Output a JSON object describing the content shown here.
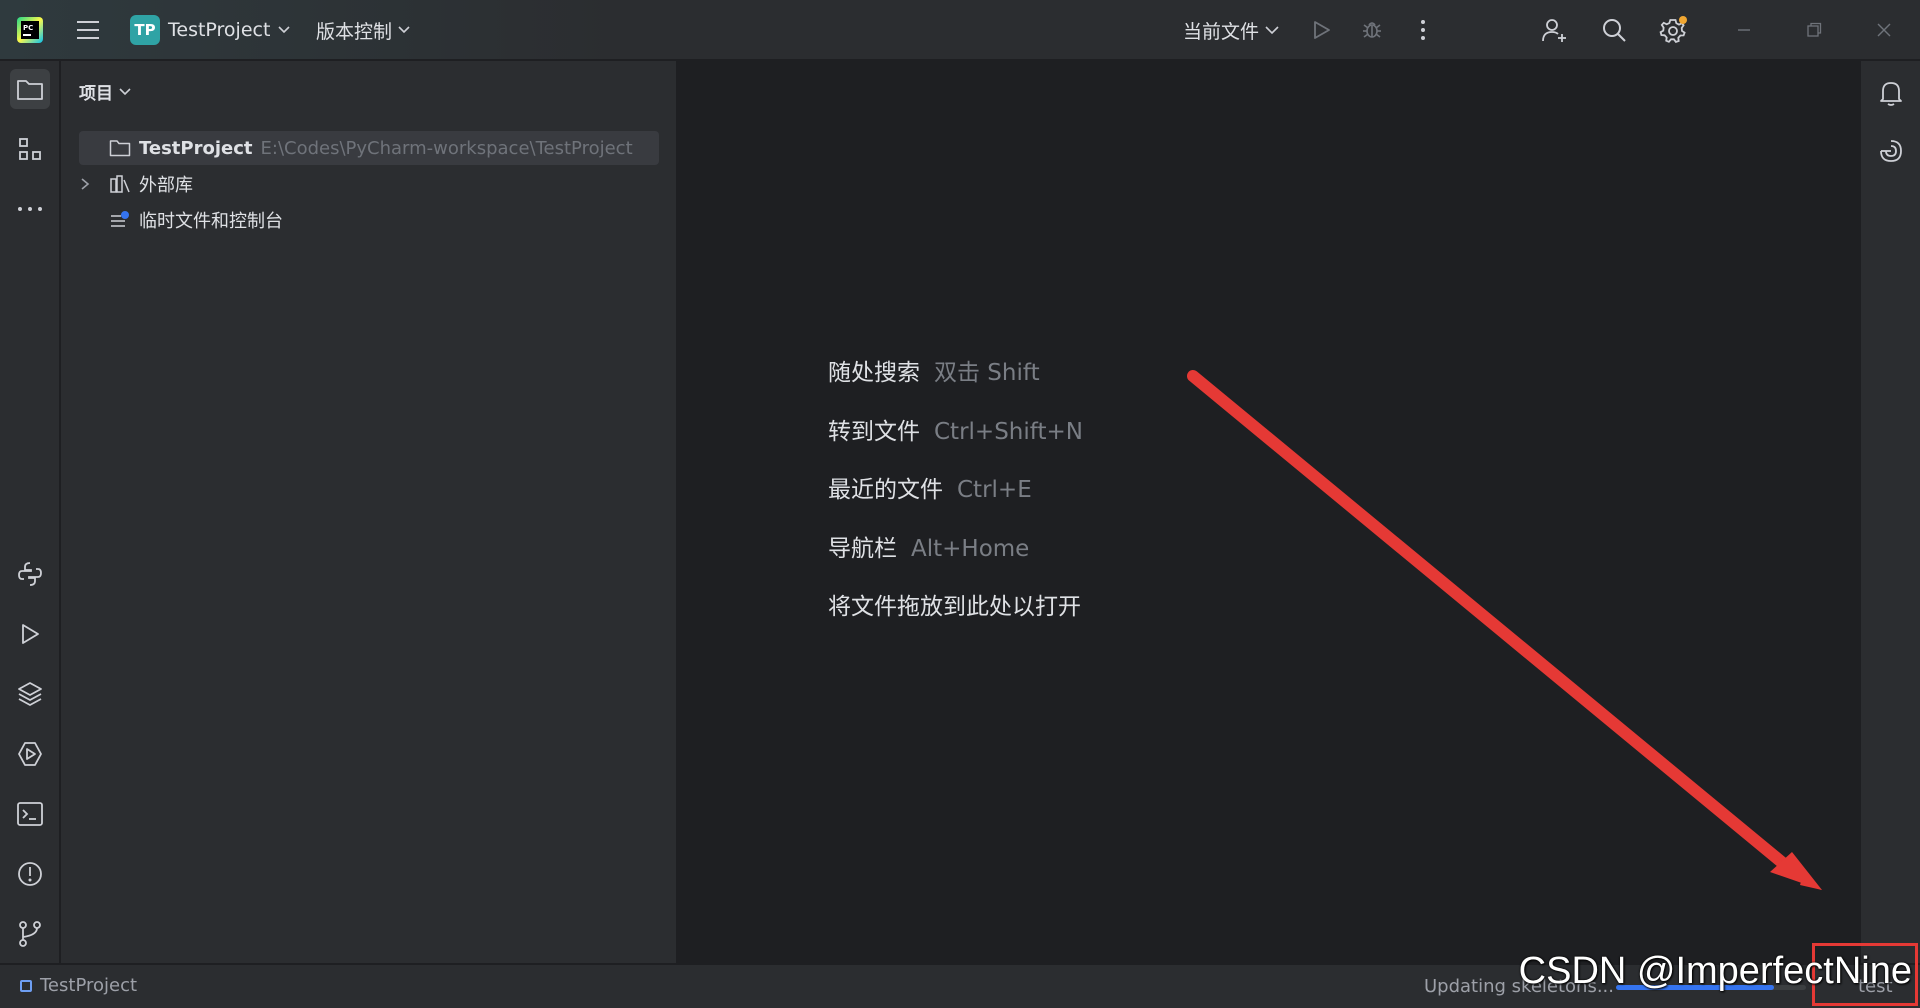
{
  "titlebar": {
    "project_badge": "TP",
    "project_name": "TestProject",
    "vcs_label": "版本控制",
    "run_config": "当前文件"
  },
  "left_strip": {
    "icons": [
      "folder-icon",
      "structure-icon",
      "more-icon",
      "python-console-icon",
      "run-icon",
      "layers-icon",
      "services-icon",
      "terminal-icon",
      "problems-icon",
      "git-icon"
    ]
  },
  "project_panel": {
    "title": "项目",
    "tree": [
      {
        "name": "TestProject",
        "path": "E:\\Codes\\PyCharm-workspace\\TestProject"
      },
      {
        "name": "外部库"
      },
      {
        "name": "临时文件和控制台"
      }
    ]
  },
  "editor": {
    "hints": [
      {
        "label": "随处搜索",
        "key": "双击 Shift"
      },
      {
        "label": "转到文件",
        "key": "Ctrl+Shift+N"
      },
      {
        "label": "最近的文件",
        "key": "Ctrl+E"
      },
      {
        "label": "导航栏",
        "key": "Alt+Home"
      },
      {
        "label": "将文件拖放到此处以打开",
        "key": ""
      }
    ]
  },
  "statusbar": {
    "project": "TestProject",
    "progress_text": "Updating skeletons...",
    "progress_fraction": 0.83,
    "interpreter": "test"
  },
  "annotation": {
    "watermark": "CSDN @ImperfectNine",
    "arrow_color": "#e53935"
  }
}
